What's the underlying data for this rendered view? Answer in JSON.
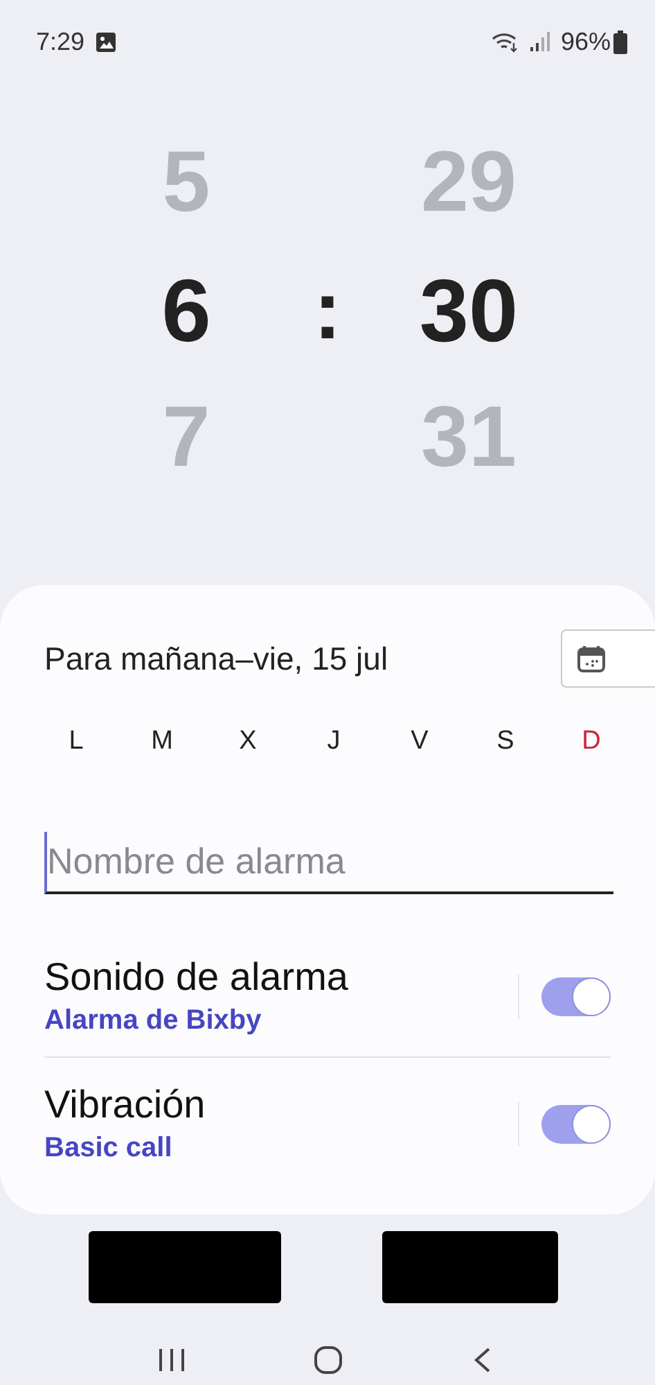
{
  "status_bar": {
    "time": "7:29",
    "battery": "96%"
  },
  "picker": {
    "hours": [
      {
        "value": "5",
        "selected": false
      },
      {
        "value": "6",
        "selected": true
      },
      {
        "value": "7",
        "selected": false
      }
    ],
    "separator": ":",
    "minutes": [
      {
        "value": "29",
        "selected": false
      },
      {
        "value": "30",
        "selected": true
      },
      {
        "value": "31",
        "selected": false
      }
    ]
  },
  "date_label": "Para mañana–vie, 15 jul",
  "days": [
    {
      "label": "L",
      "selected": false,
      "color": "#222222"
    },
    {
      "label": "M",
      "selected": false,
      "color": "#222222"
    },
    {
      "label": "X",
      "selected": false,
      "color": "#222222"
    },
    {
      "label": "J",
      "selected": false,
      "color": "#222222"
    },
    {
      "label": "V",
      "selected": false,
      "color": "#222222"
    },
    {
      "label": "S",
      "selected": false,
      "color": "#222222"
    },
    {
      "label": "D",
      "selected": false,
      "color": "#d0213f"
    }
  ],
  "alarm_name": {
    "placeholder": "Nombre de alarma"
  },
  "settings": [
    {
      "title": "Sonido de alarma",
      "subtitle": "Alarma de Bixby",
      "on": true
    },
    {
      "title": "Vibración",
      "subtitle": "Basic call",
      "on": true
    }
  ]
}
